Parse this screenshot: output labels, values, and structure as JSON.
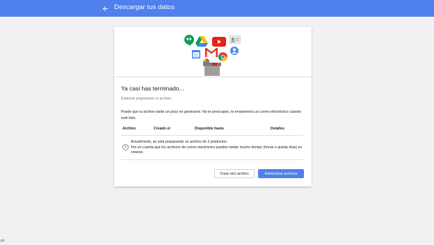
{
  "topbar": {
    "title": "Descargar tus datos",
    "back_icon": "arrow-back-icon",
    "color": "#4f80ee"
  },
  "hero": {
    "icons": [
      "hangouts-icon",
      "drive-icon",
      "youtube-icon",
      "contacts-icon",
      "calendar-icon",
      "gmail-icon",
      "chrome-icon",
      "profile-icon",
      "photos-icon",
      "box-icon"
    ]
  },
  "main": {
    "heading": "Ya casi has terminado...",
    "subheading": "Estamos preparando tu archivo",
    "paragraph": "Puede que tu archivo tarde un poco en generarse. No te preocupes, te enviaremos un correo electrónico cuando esté listo."
  },
  "table": {
    "headers": [
      "Archivo",
      "Creado el",
      "Disponible hasta",
      "Detalles"
    ],
    "status_icon": "clock-icon",
    "status_line1": "Actualmente, se está preparando un archivo de 2 productos.",
    "status_line2": "Ten en cuenta que los archivos de correo electrónico pueden tardar mucho tiempo (horas o quizás días) en crearse."
  },
  "actions": {
    "secondary": "Crear otro archivo",
    "primary": "Administrar archivos"
  },
  "footer": {
    "text": "ula"
  }
}
